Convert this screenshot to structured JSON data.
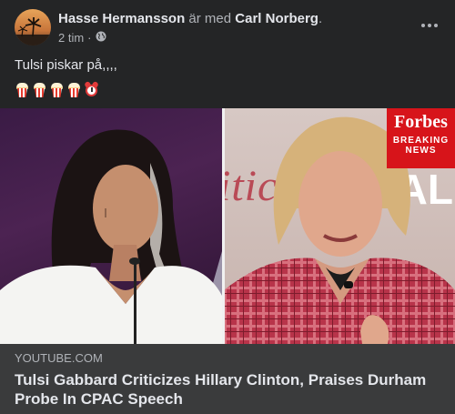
{
  "post": {
    "author": "Hasse Hermansson",
    "with_text": "är med",
    "tagged": "Carl Norberg",
    "after_tag": ".",
    "time": "2 tim",
    "dot": "·",
    "text": "Tulsi piskar på,,,,"
  },
  "emojis": [
    "popcorn-emoji",
    "popcorn-emoji",
    "popcorn-emoji",
    "popcorn-emoji",
    "alarm-clock-emoji"
  ],
  "link_preview": {
    "badge": {
      "brand": "Forbes",
      "line1": "BREAKING",
      "line2": "NEWS"
    },
    "backdrop_left": "itic",
    "backdrop_right": "AL",
    "domain": "YOUTUBE.COM",
    "headline": "Tulsi Gabbard Criticizes Hillary Clinton, Praises Durham Probe In CPAC Speech"
  },
  "colors": {
    "background": "#242526",
    "caption_bg": "#3a3b3c",
    "primary_text": "#e4e6eb",
    "secondary_text": "#b0b3b8",
    "forbes_red": "#d7141a"
  },
  "icons": [
    "globe-icon",
    "more-options-icon"
  ]
}
